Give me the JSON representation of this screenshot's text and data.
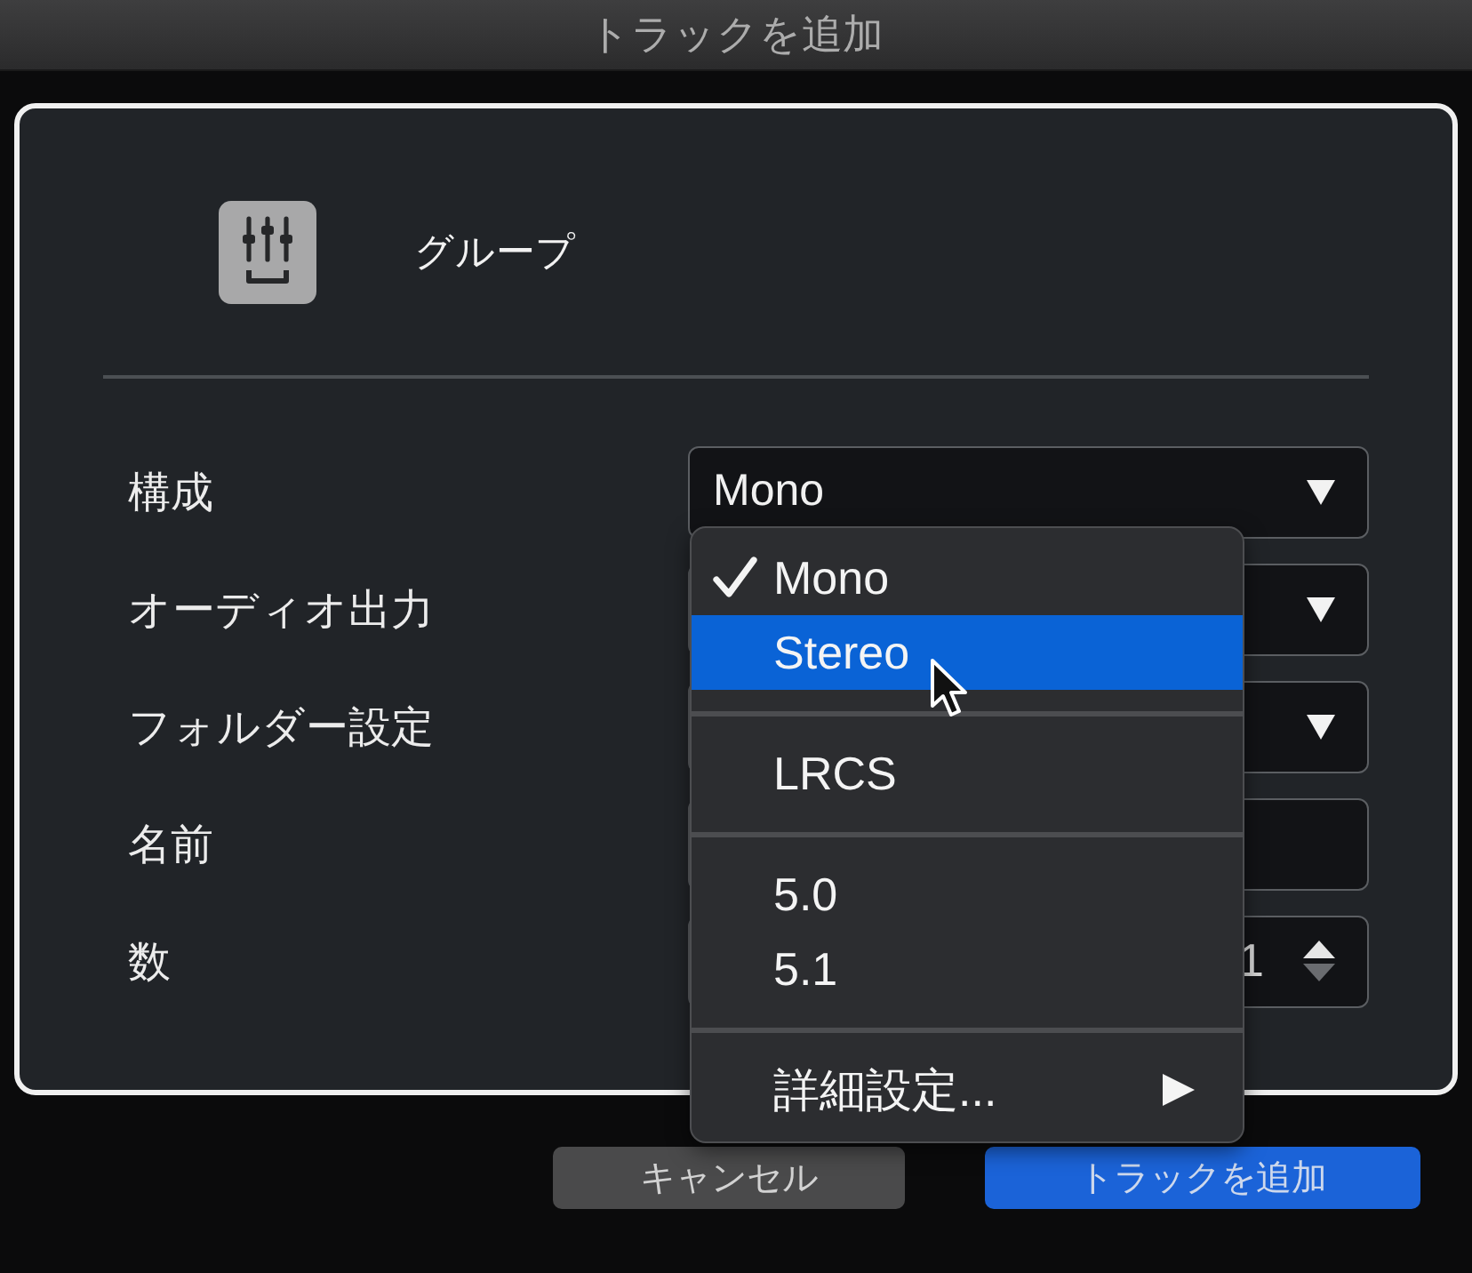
{
  "window": {
    "title": "トラックを追加"
  },
  "track_type": {
    "label": "グループ"
  },
  "form": [
    {
      "kind": "select",
      "label": "構成",
      "value": "Mono"
    },
    {
      "kind": "select",
      "label": "オーディオ出力"
    },
    {
      "kind": "select",
      "label": "フォルダー設定"
    },
    {
      "kind": "text",
      "label": "名前"
    },
    {
      "kind": "number",
      "label": "数",
      "value": "1",
      "up_enabled": true,
      "down_enabled": false
    }
  ],
  "menu": {
    "groups": [
      {
        "items": [
          {
            "label": "Mono",
            "checked": true,
            "selected": false,
            "submenu": false
          },
          {
            "label": "Stereo",
            "checked": false,
            "selected": true,
            "submenu": false
          }
        ]
      },
      {
        "items": [
          {
            "label": "LRCS",
            "checked": false,
            "selected": false,
            "submenu": false
          }
        ]
      },
      {
        "items": [
          {
            "label": "5.0",
            "checked": false,
            "selected": false,
            "submenu": false
          },
          {
            "label": "5.1",
            "checked": false,
            "selected": false,
            "submenu": false
          }
        ]
      },
      {
        "items": [
          {
            "label": "詳細設定...",
            "checked": false,
            "selected": false,
            "submenu": true
          }
        ]
      }
    ]
  },
  "buttons": [
    {
      "label": "キャンセル",
      "kind": "secondary"
    },
    {
      "label": "トラックを追加",
      "kind": "primary"
    }
  ]
}
